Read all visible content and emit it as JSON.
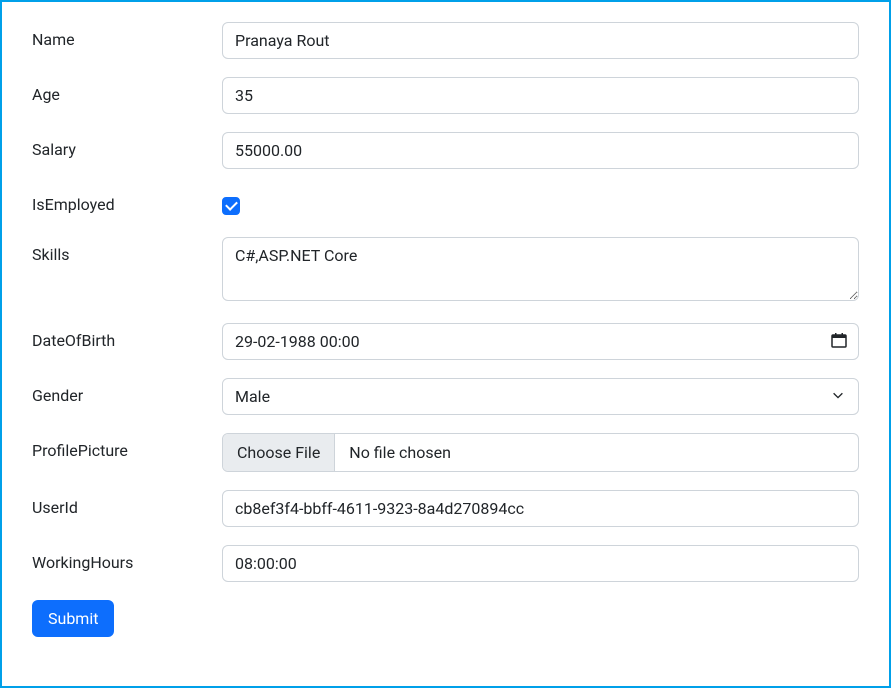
{
  "form": {
    "name": {
      "label": "Name",
      "value": "Pranaya Rout"
    },
    "age": {
      "label": "Age",
      "value": "35"
    },
    "salary": {
      "label": "Salary",
      "value": "55000.00"
    },
    "isEmployed": {
      "label": "IsEmployed",
      "checked": true
    },
    "skills": {
      "label": "Skills",
      "value": "C#,ASP.NET Core"
    },
    "dateOfBirth": {
      "label": "DateOfBirth",
      "value": "29-02-1988 00:00"
    },
    "gender": {
      "label": "Gender",
      "value": "Male"
    },
    "profilePicture": {
      "label": "ProfilePicture",
      "buttonText": "Choose File",
      "fileText": "No file chosen"
    },
    "userId": {
      "label": "UserId",
      "value": "cb8ef3f4-bbff-4611-9323-8a4d270894cc"
    },
    "workingHours": {
      "label": "WorkingHours",
      "value": "08:00:00"
    },
    "submit": {
      "label": "Submit"
    }
  }
}
